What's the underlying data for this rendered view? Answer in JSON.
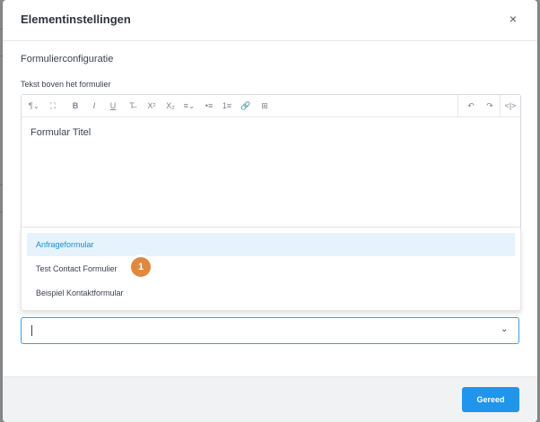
{
  "modal": {
    "title": "Elementinstellingen",
    "close_icon": "×"
  },
  "form": {
    "section_title": "Formulierconfiguratie",
    "field_label": "Tekst boven het formulier",
    "editor_content": "Formular Titel"
  },
  "toolbar": {
    "buttons": [
      {
        "name": "paragraph-format-icon",
        "glyph": "¶⌄"
      },
      {
        "name": "clear-format-icon",
        "glyph": "⛶"
      },
      {
        "name": "bold-icon",
        "glyph": "B"
      },
      {
        "name": "italic-icon",
        "glyph": "I"
      },
      {
        "name": "underline-icon",
        "glyph": "U"
      },
      {
        "name": "strikethrough-icon",
        "glyph": "T̶"
      },
      {
        "name": "superscript-icon",
        "glyph": "X²"
      },
      {
        "name": "subscript-icon",
        "glyph": "X₂"
      },
      {
        "name": "align-icon",
        "glyph": "≡⌄"
      },
      {
        "name": "bullet-list-icon",
        "glyph": "•≡"
      },
      {
        "name": "numbered-list-icon",
        "glyph": "1≡"
      },
      {
        "name": "link-icon",
        "glyph": "🔗"
      },
      {
        "name": "table-icon",
        "glyph": "⊞"
      },
      {
        "name": "undo-icon",
        "glyph": "↶"
      },
      {
        "name": "redo-icon",
        "glyph": "↷"
      },
      {
        "name": "code-view-icon",
        "glyph": "<|>"
      }
    ]
  },
  "dropdown": {
    "options": [
      "Anfrageformular",
      "Test Contact Formulier",
      "Beispiel Kontaktformular"
    ],
    "selected_index": 0
  },
  "step_badge": "1",
  "select": {
    "value": "",
    "chevron_icon": "⌄"
  },
  "footer": {
    "done_label": "Gereed"
  },
  "colors": {
    "accent": "#1f95ec",
    "selected_bg": "#e6f3fc",
    "badge": "#e0883c"
  }
}
